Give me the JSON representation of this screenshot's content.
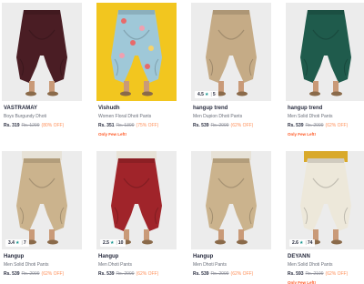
{
  "products": [
    {
      "brand": "VASTRAMAY",
      "desc": "Boys Burgundy Dhoti",
      "price": "Rs. 319",
      "mrp": "Rs. 1299",
      "off": "(80% OFF)",
      "left": "",
      "rating": "",
      "rating_count": "",
      "color": "#4a1d24",
      "bg": "#ececec"
    },
    {
      "brand": "Vishudh",
      "desc": "Women Floral Dhoti Pants",
      "price": "Rs. 351",
      "mrp": "Rs. 1399",
      "off": "(75% OFF)",
      "left": "Only Few Left!",
      "rating": "",
      "rating_count": "",
      "color": "#9fc8d8",
      "bg": "#f2c61f"
    },
    {
      "brand": "hangup trend",
      "desc": "Men Dupion Dhoti Pants",
      "price": "Rs. 539",
      "mrp": "Rs. 2099",
      "off": "(62% OFF)",
      "left": "",
      "rating": "4.5",
      "rating_count": "5",
      "color": "#c5ab86",
      "bg": "#ececec"
    },
    {
      "brand": "hangup trend",
      "desc": "Men Solid Dhoti Pants",
      "price": "Rs. 539",
      "mrp": "Rs. 2099",
      "off": "(62% OFF)",
      "left": "Only Few Left!",
      "rating": "",
      "rating_count": "",
      "color": "#1f5b4c",
      "bg": "#ececec"
    },
    {
      "brand": "Hangup",
      "desc": "Men Solid Dhoti Pants",
      "price": "Rs. 539",
      "mrp": "Rs. 2099",
      "off": "(62% OFF)",
      "left": "",
      "rating": "3.4",
      "rating_count": "7",
      "color": "#cbb38d",
      "bg": "#ececec"
    },
    {
      "brand": "Hangup",
      "desc": "Men Dhoti Pants",
      "price": "Rs. 539",
      "mrp": "Rs. 2099",
      "off": "(62% OFF)",
      "left": "",
      "rating": "2.5",
      "rating_count": "10",
      "color": "#a0242a",
      "bg": "#ececec"
    },
    {
      "brand": "Hangup",
      "desc": "Men Dhoti Pants",
      "price": "Rs. 539",
      "mrp": "Rs. 2099",
      "off": "(62% OFF)",
      "left": "",
      "rating": "",
      "rating_count": "",
      "color": "#cbb38d",
      "bg": "#ececec"
    },
    {
      "brand": "DEYANN",
      "desc": "Men Solid Dhoti Pants",
      "price": "Rs. 593",
      "mrp": "Rs. 2199",
      "off": "(62% OFF)",
      "left": "Only Few Left!",
      "rating": "2.6",
      "rating_count": "74",
      "color": "#ede8da",
      "bg": "#ececec"
    }
  ]
}
